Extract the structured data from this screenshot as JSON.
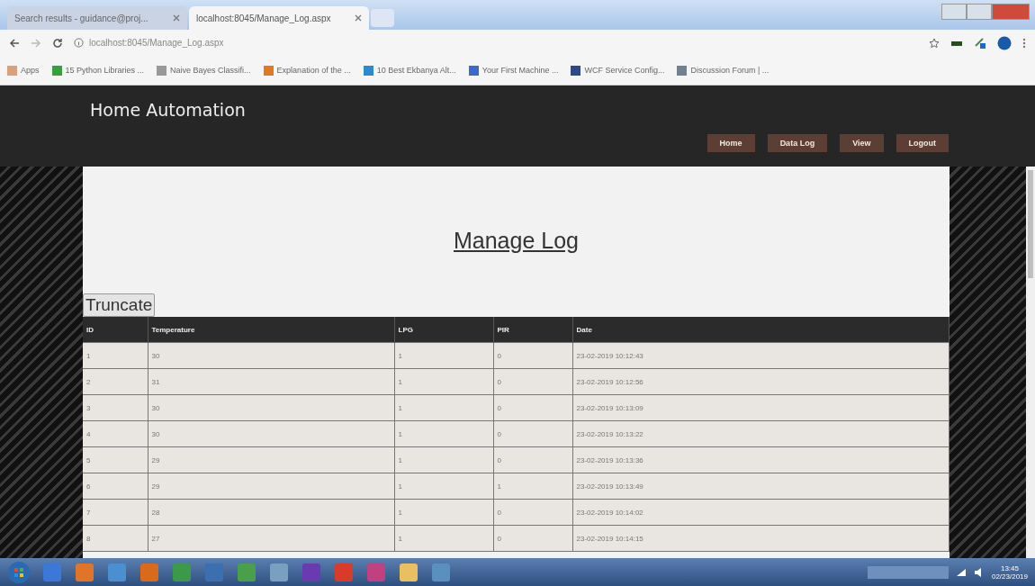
{
  "browser": {
    "tabs": [
      {
        "title": "Search results - guidance@proj...",
        "selected": false
      },
      {
        "title": "localhost:8045/Manage_Log.aspx",
        "selected": true
      }
    ],
    "address": "localhost:8045/Manage_Log.aspx",
    "bookmarks": [
      "Apps",
      "15 Python Libraries ...",
      "Naive Bayes Classifi...",
      "Explanation of the ...",
      "10 Best Ekbanya Alt...",
      "Your First Machine ...",
      "WCF Service Config...",
      "Discussion Forum | ..."
    ]
  },
  "site": {
    "title": "Home Automation",
    "nav": [
      "Home",
      "Data Log",
      "View",
      "Logout"
    ]
  },
  "page": {
    "heading": "Manage Log",
    "truncate_button": "Truncate",
    "table": {
      "columns": [
        "ID",
        "Temperature",
        "LPG",
        "PIR",
        "Date"
      ],
      "rows": [
        [
          "1",
          "30",
          "1",
          "0",
          "23-02-2019 10:12:43"
        ],
        [
          "2",
          "31",
          "1",
          "0",
          "23-02-2019 10:12:56"
        ],
        [
          "3",
          "30",
          "1",
          "0",
          "23-02-2019 10:13:09"
        ],
        [
          "4",
          "30",
          "1",
          "0",
          "23-02-2019 10:13:22"
        ],
        [
          "5",
          "29",
          "1",
          "0",
          "23-02-2019 10:13:36"
        ],
        [
          "6",
          "29",
          "1",
          "1",
          "23-02-2019 10:13:49"
        ],
        [
          "7",
          "28",
          "1",
          "0",
          "23-02-2019 10:14:02"
        ],
        [
          "8",
          "27",
          "1",
          "0",
          "23-02-2019 10:14:15"
        ]
      ]
    }
  },
  "taskbar": {
    "time": "13:45",
    "date": "02/23/2019"
  }
}
